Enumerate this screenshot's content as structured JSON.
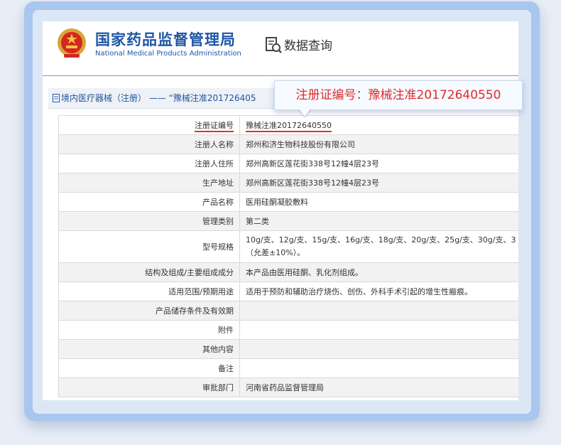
{
  "header": {
    "org_name_cn": "国家药品监督管理局",
    "org_name_en": "National Medical Products Administration",
    "query_label": "数据查询"
  },
  "breadcrumb": {
    "text": "境内医疗器械（注册） —— “豫械注准201726405"
  },
  "callout": {
    "text": "注册证编号：豫械注准20172640550"
  },
  "rows": [
    {
      "label": "注册证编号",
      "value": "豫械注准20172640550"
    },
    {
      "label": "注册人名称",
      "value": "郑州和济生物科技股份有限公司"
    },
    {
      "label": "注册人住所",
      "value": "郑州高新区莲花街338号12幢4层23号"
    },
    {
      "label": "生产地址",
      "value": "郑州高新区莲花街338号12幢4层23号"
    },
    {
      "label": "产品名称",
      "value": "医用硅酮凝胶敷料"
    },
    {
      "label": "管理类别",
      "value": "第二类"
    },
    {
      "label": "型号规格",
      "value": "10g/支、12g/支、15g/支、16g/支、18g/支、20g/支、25g/支、30g/支、3",
      "value2": "（允差±10%）。"
    },
    {
      "label": "结构及组成/主要组成成分",
      "value": "本产品由医用硅酮、乳化剂组成。"
    },
    {
      "label": "适用范围/预期用途",
      "value": "适用于预防和辅助治疗烧伤、创伤、外科手术引起的增生性瘢痕。"
    },
    {
      "label": "产品储存条件及有效期",
      "value": ""
    },
    {
      "label": "附件",
      "value": ""
    },
    {
      "label": "其他内容",
      "value": ""
    },
    {
      "label": "备注",
      "value": ""
    },
    {
      "label": "审批部门",
      "value": "河南省药品监督管理局"
    }
  ],
  "colors": {
    "brand_blue": "#1f56a7",
    "highlight_red": "#e02b2b",
    "frame_blue": "#a9c6ef"
  },
  "icons": [
    "national-emblem-icon",
    "query-doc-icon",
    "document-icon"
  ]
}
